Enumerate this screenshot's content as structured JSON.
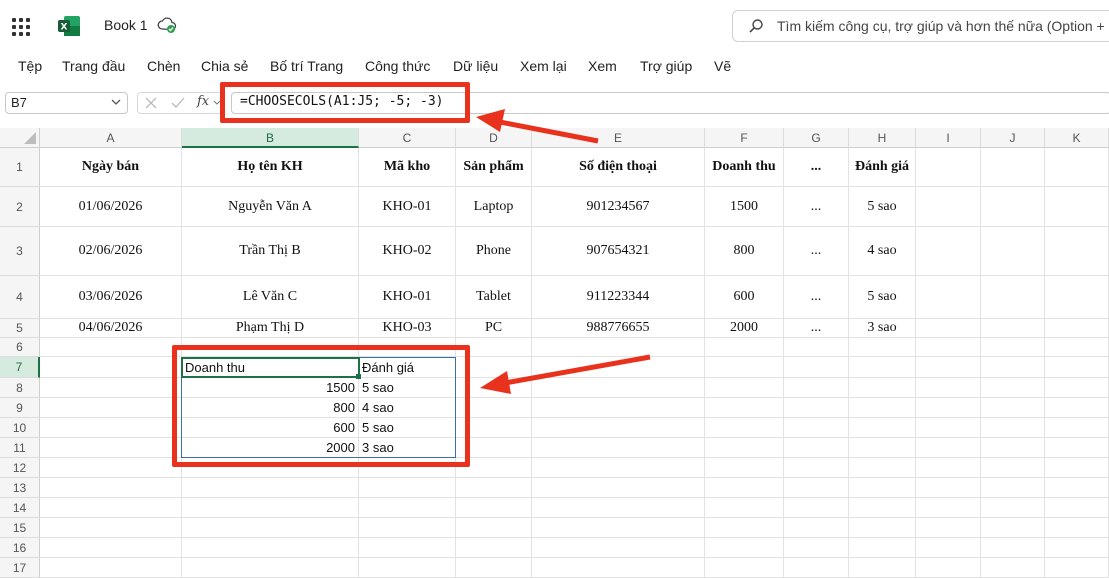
{
  "app": {
    "title": "Book 1"
  },
  "search": {
    "placeholder": "Tìm kiếm công cụ, trợ giúp và hơn thế nữa (Option + Q)"
  },
  "menu": [
    "Tệp",
    "Trang đầu",
    "Chèn",
    "Chia sẻ",
    "Bố trí Trang",
    "Công thức",
    "Dữ liệu",
    "Xem lại",
    "Xem",
    "Trợ giúp",
    "Vẽ"
  ],
  "formula_bar": {
    "name_box": "B7",
    "fx": "fx",
    "formula": "=CHOOSECOLS(A1:J5; -5; -3)"
  },
  "columns": [
    "A",
    "B",
    "C",
    "D",
    "E",
    "F",
    "G",
    "H",
    "I",
    "J",
    "K"
  ],
  "rows": [
    "1",
    "2",
    "3",
    "4",
    "5",
    "6",
    "7",
    "8",
    "9",
    "10",
    "11",
    "12",
    "13",
    "14",
    "15",
    "16",
    "17"
  ],
  "table": {
    "headers": [
      "Ngày bán",
      "Họ tên KH",
      "Mã kho",
      "Sản phẩm",
      "Số điện thoại",
      "Doanh thu",
      "...",
      "Đánh giá"
    ],
    "rows": [
      [
        "01/06/2026",
        "Nguyễn Văn A",
        "KHO-01",
        "Laptop",
        "901234567",
        "1500",
        "...",
        "5 sao"
      ],
      [
        "02/06/2026",
        "Trần Thị B",
        "KHO-02",
        "Phone",
        "907654321",
        "800",
        "...",
        "4 sao"
      ],
      [
        "03/06/2026",
        "Lê Văn C",
        "KHO-01",
        "Tablet",
        "911223344",
        "600",
        "...",
        "5 sao"
      ],
      [
        "04/06/2026",
        "Phạm Thị D",
        "KHO-03",
        "PC",
        "988776655",
        "2000",
        "...",
        "3 sao"
      ]
    ]
  },
  "result": {
    "headers": [
      "Doanh thu",
      "Đánh giá"
    ],
    "rows": [
      [
        "1500",
        "5 sao"
      ],
      [
        "800",
        "4 sao"
      ],
      [
        "600",
        "5 sao"
      ],
      [
        "2000",
        "3 sao"
      ]
    ]
  },
  "colors": {
    "annotation": "#e8321e",
    "excel_green": "#1e7145",
    "selection": "#d6ebdf"
  }
}
